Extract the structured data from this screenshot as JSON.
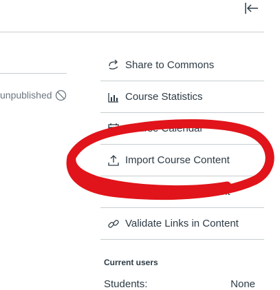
{
  "menu": {
    "items": [
      {
        "label": "Share to Commons",
        "icon": "share-icon"
      },
      {
        "label": "Course Statistics",
        "icon": "statistics-icon"
      },
      {
        "label": "Course Calendar",
        "icon": "calendar-icon"
      },
      {
        "label": "Import Course Content",
        "icon": "upload-icon"
      },
      {
        "label": "Export Course Content",
        "icon": "download-icon"
      },
      {
        "label": "Validate Links in Content",
        "icon": "link-icon"
      }
    ]
  },
  "status": {
    "label": "unpublished",
    "icon": "unpublished-icon"
  },
  "current_users": {
    "title": "Current users",
    "students_label": "Students:",
    "students_value": "None"
  },
  "colors": {
    "annotation": "#e0141a",
    "divider": "#c7cdd1",
    "text": "#2d3b45"
  }
}
